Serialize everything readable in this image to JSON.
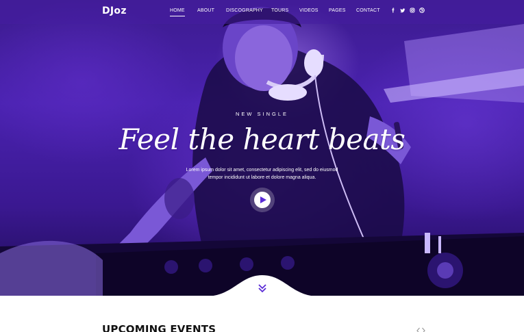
{
  "brand": {
    "logo": "DJoz"
  },
  "nav": {
    "items": [
      "HOME",
      "ABOUT",
      "DISCOGRAPHY",
      "TOURS",
      "VIDEOS",
      "PAGES",
      "CONTACT"
    ],
    "active": "HOME"
  },
  "social": [
    "facebook-icon",
    "twitter-icon",
    "instagram-icon",
    "dribbble-icon"
  ],
  "hero": {
    "kicker": "NEW SINGLE",
    "title": "Feel the heart beats",
    "description": [
      "Lorem ipsum dolor sit amet, consectetur adipiscing elit, sed do eiusmod",
      "tempor incididunt ut labore et dolore magna aliqua."
    ],
    "play_icon": "play-icon",
    "scroll_icon": "double-chevron-down-icon"
  },
  "events": {
    "heading": "UPCOMING EVENTS",
    "prev_icon": "chevron-left-icon",
    "next_icon": "chevron-right-icon"
  },
  "colors": {
    "accent": "#5a2bd6",
    "hero_dark": "#1e0c55",
    "nav_bg": "#461ea0",
    "text": "#ffffff"
  }
}
